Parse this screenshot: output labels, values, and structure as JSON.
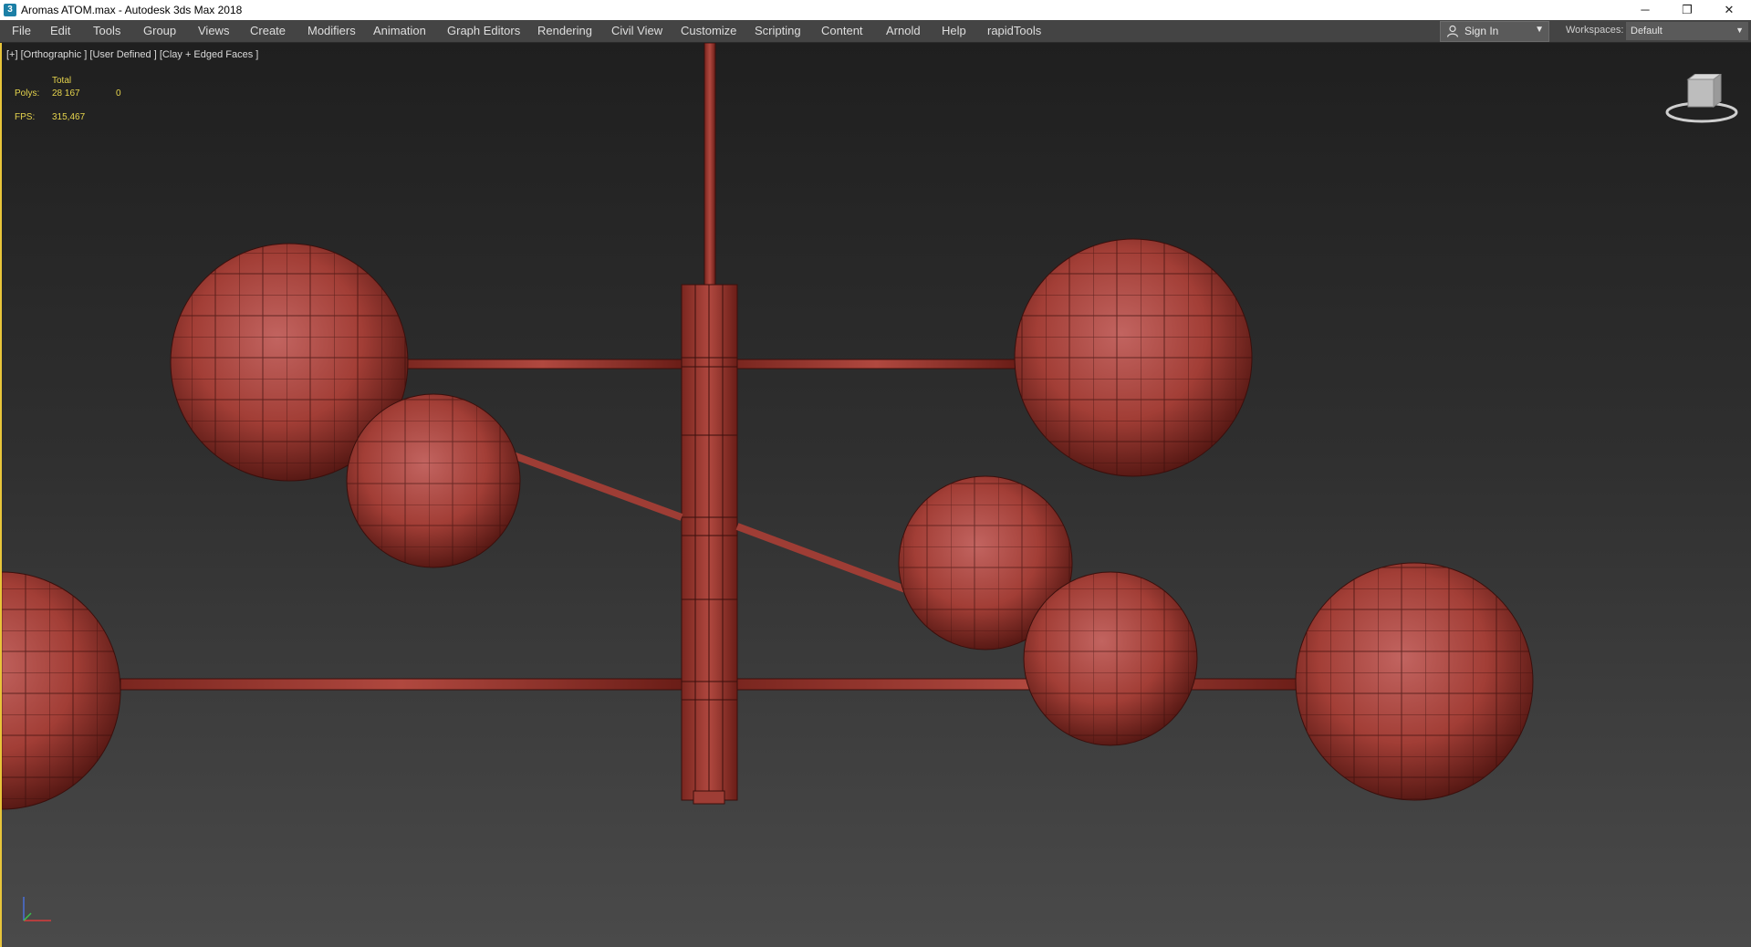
{
  "window": {
    "title": "Aromas ATOM.max - Autodesk 3ds Max 2018",
    "controls": {
      "minimize": "─",
      "restore": "❐",
      "close": "✕"
    }
  },
  "menu": {
    "items": [
      "File",
      "Edit",
      "Tools",
      "Group",
      "Views",
      "Create",
      "Modifiers",
      "Animation",
      "Graph Editors",
      "Rendering",
      "Civil View",
      "Customize",
      "Scripting",
      "Content",
      "Arnold",
      "Help",
      "rapidTools"
    ]
  },
  "signin": {
    "label": "Sign In"
  },
  "workspaces": {
    "label": "Workspaces:",
    "value": "Default"
  },
  "viewport": {
    "label": "[+] [Orthographic ] [User Defined ] [Clay + Edged Faces ]",
    "stats": {
      "total_header": "Total",
      "polys_label": "Polys:",
      "polys_value": "28 167",
      "polys_selected": "0",
      "fps_label": "FPS:",
      "fps_value": "315,467"
    }
  },
  "colors": {
    "accent": "#e8c53a",
    "stats_text": "#e6d44d",
    "model_fill": "#a8423a",
    "model_edge": "#3a0f0c"
  }
}
